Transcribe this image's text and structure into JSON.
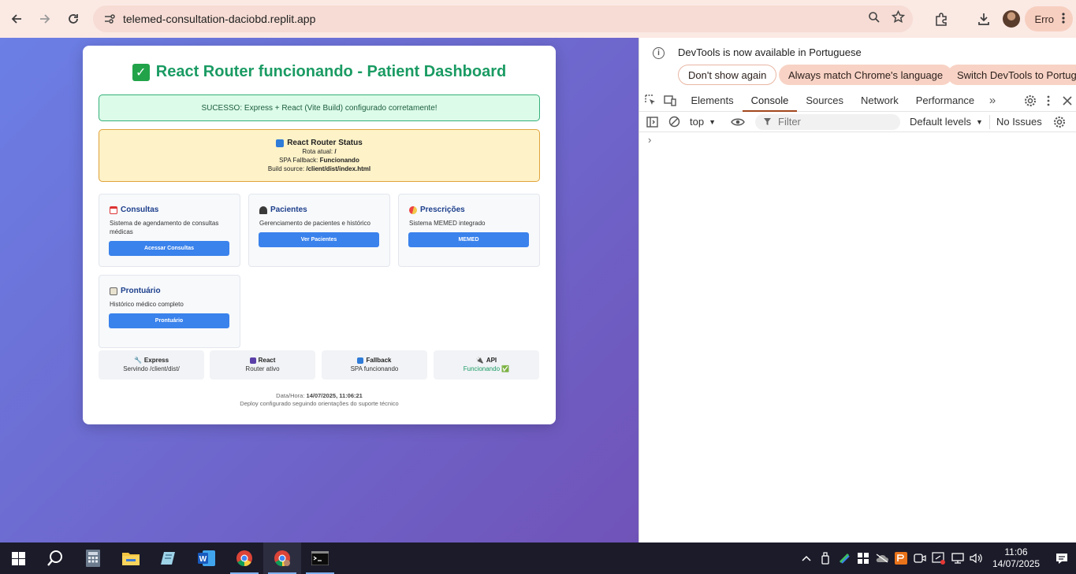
{
  "browser": {
    "url": "telemed-consultation-daciobd.replit.app",
    "profile_label": "Erro"
  },
  "page": {
    "title": "React Router funcionando - Patient Dashboard",
    "success_banner": "SUCESSO: Express + React (Vite Build) configurado corretamente!",
    "status": {
      "title": "React Router Status",
      "route_label": "Rota atual:",
      "route_value": "/",
      "fallback_label": "SPA Fallback:",
      "fallback_value": "Funcionando",
      "build_label": "Build source:",
      "build_value": "/client/dist/index.html"
    },
    "features": [
      {
        "title": "Consultas",
        "description": "Sistema de agendamento de consultas médicas",
        "button": "Acessar Consultas"
      },
      {
        "title": "Pacientes",
        "description": "Gerenciamento de pacientes e histórico",
        "button": "Ver Pacientes"
      },
      {
        "title": "Prescrições",
        "description": "Sistema MEMED integrado",
        "button": "MEMED"
      },
      {
        "title": "Prontuário",
        "description": "Histórico médico completo",
        "button": "Prontuário"
      }
    ],
    "stats": [
      {
        "title": "Express",
        "subtitle": "Servindo /client/dist/"
      },
      {
        "title": "React",
        "subtitle": "Router ativo"
      },
      {
        "title": "Fallback",
        "subtitle": "SPA funcionando"
      },
      {
        "title": "API",
        "subtitle": "Funcionando ✅"
      }
    ],
    "footer": {
      "datetime_label": "Data/Hora:",
      "datetime_value": "14/07/2025, 11:06:21",
      "note": "Deploy configurado seguindo orientações do suporte técnico"
    }
  },
  "devtools": {
    "info_message": "DevTools is now available in Portuguese",
    "buttons": [
      "Don't show again",
      "Always match Chrome's language",
      "Switch DevTools to Portuguese"
    ],
    "tabs": [
      "Elements",
      "Console",
      "Sources",
      "Network",
      "Performance"
    ],
    "active_tab": "Console",
    "context": "top",
    "filter_placeholder": "Filter",
    "levels": "Default levels",
    "issues": "No Issues",
    "prompt": "›"
  },
  "taskbar": {
    "time": "11:06",
    "date": "14/07/2025"
  },
  "colors": {
    "title_green": "#1a9b63",
    "button_blue": "#3a82ec",
    "devtools_accent": "#a2461d"
  }
}
